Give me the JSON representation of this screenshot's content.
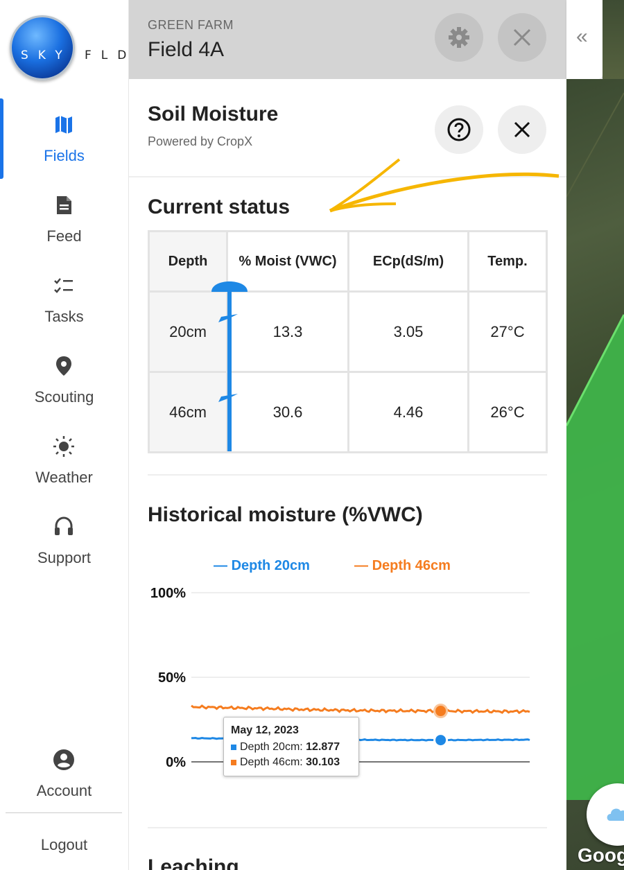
{
  "app": {
    "logo_inner": "SKY",
    "logo_outer": "FLD"
  },
  "sidebar": {
    "items": [
      {
        "label": "Fields",
        "icon": "map-icon",
        "active": true
      },
      {
        "label": "Feed",
        "icon": "document-icon",
        "active": false
      },
      {
        "label": "Tasks",
        "icon": "checklist-icon",
        "active": false
      },
      {
        "label": "Scouting",
        "icon": "location-pin-icon",
        "active": false
      },
      {
        "label": "Weather",
        "icon": "sun-icon",
        "active": false
      },
      {
        "label": "Support",
        "icon": "headset-icon",
        "active": false
      }
    ],
    "account_label": "Account",
    "logout_label": "Logout"
  },
  "header": {
    "farm": "GREEN FARM",
    "field": "Field 4A",
    "collapse_glyph": "«"
  },
  "panel": {
    "title": "Soil Moisture",
    "subtitle": "Powered by CropX",
    "status_title": "Current status",
    "table": {
      "headers": [
        "Depth",
        "% Moist (VWC)",
        "ECp(dS/m)",
        "Temp."
      ],
      "rows": [
        [
          "20cm",
          "13.3",
          "3.05",
          "27°C"
        ],
        [
          "46cm",
          "30.6",
          "4.46",
          "26°C"
        ]
      ]
    },
    "historical_title": "Historical moisture (%VWC)",
    "leaching_title": "Leaching"
  },
  "tooltip": {
    "date": "May 12, 2023",
    "row1_label": "Depth 20cm: ",
    "row1_value": "12.877",
    "row2_label": "Depth 46cm: ",
    "row2_value": "30.103"
  },
  "map": {
    "attribution": "Goog"
  },
  "colors": {
    "accent": "#1a73e8",
    "series20": "#1e88e5",
    "series46": "#f57c1f",
    "arrow": "#f6b600"
  },
  "chart_data": {
    "type": "line",
    "title": "Historical moisture (%VWC)",
    "ylim": [
      0,
      100
    ],
    "yticks": [
      "0%",
      "50%",
      "100%"
    ],
    "xlabel": "",
    "ylabel": "",
    "legend_position": "top",
    "series": [
      {
        "name": "Depth 20cm",
        "color": "#1e88e5",
        "values": [
          14.0,
          13.9,
          13.8,
          13.7,
          13.6,
          13.5,
          13.4,
          13.3,
          13.2,
          13.1,
          13.0,
          12.95,
          12.9,
          12.88,
          12.877,
          12.9,
          12.95,
          13.0,
          13.05,
          13.1
        ]
      },
      {
        "name": "Depth 46cm",
        "color": "#f57c1f",
        "values": [
          32.5,
          32.3,
          32.0,
          31.8,
          31.6,
          31.3,
          31.0,
          30.8,
          30.6,
          30.4,
          30.3,
          30.2,
          30.15,
          30.1,
          30.103,
          30.0,
          29.9,
          29.8,
          29.8,
          29.9
        ]
      }
    ],
    "highlight_index": 14
  }
}
